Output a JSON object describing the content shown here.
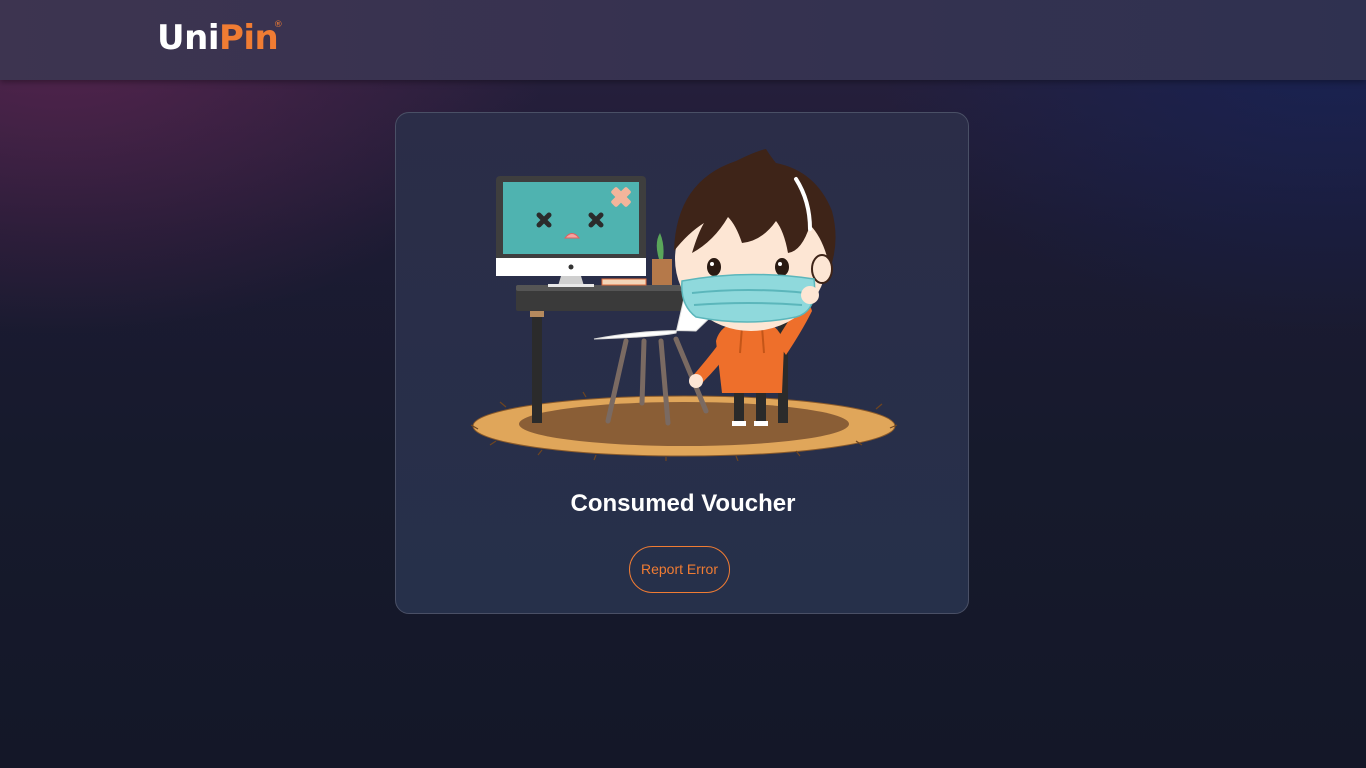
{
  "header": {
    "logo_uni": "Uni",
    "logo_pin": "Pin",
    "logo_reg": "®"
  },
  "main": {
    "title": "Consumed Voucher",
    "report_button_label": "Report Error",
    "illustration": "broken-computer-masked-boy-illustration"
  },
  "colors": {
    "accent": "#f07c33",
    "card_bg": "#272f4a",
    "page_bg": "#151829"
  }
}
